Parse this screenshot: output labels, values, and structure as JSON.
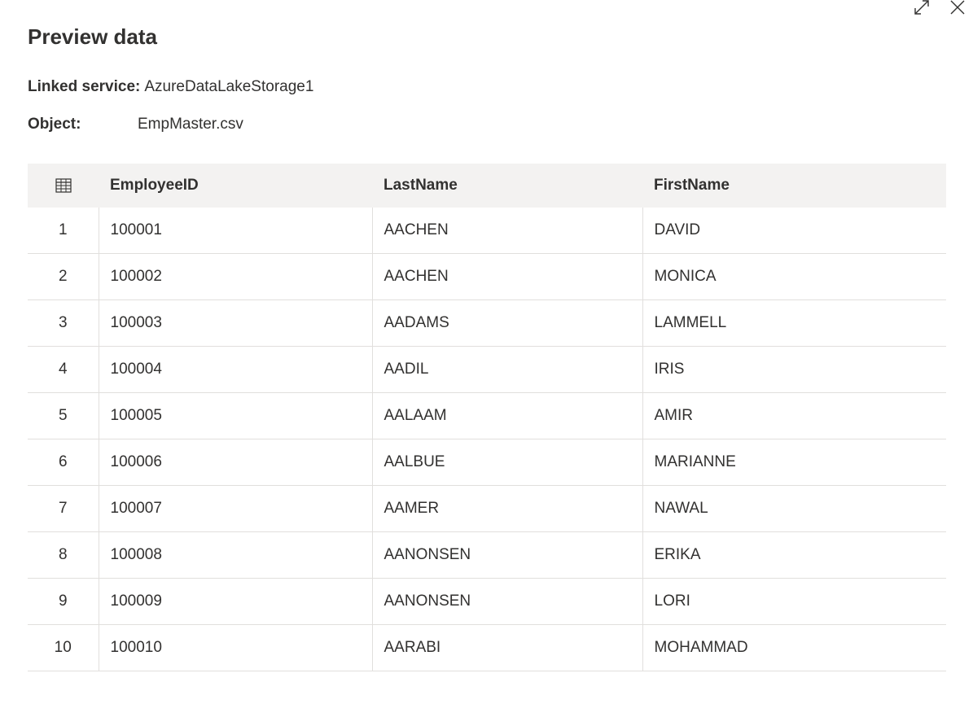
{
  "header": {
    "title": "Preview data",
    "icons": [
      "expand-icon",
      "close-icon"
    ]
  },
  "meta": {
    "linked_service_label": "Linked service:",
    "linked_service_value": "AzureDataLakeStorage1",
    "object_label": "Object:",
    "object_value": "EmpMaster.csv"
  },
  "table": {
    "index_icon": "table-icon",
    "columns": [
      "EmployeeID",
      "LastName",
      "FirstName"
    ],
    "rows": [
      {
        "idx": "1",
        "cells": [
          "100001",
          "AACHEN",
          "DAVID"
        ]
      },
      {
        "idx": "2",
        "cells": [
          "100002",
          "AACHEN",
          "MONICA"
        ]
      },
      {
        "idx": "3",
        "cells": [
          "100003",
          "AADAMS",
          "LAMMELL"
        ]
      },
      {
        "idx": "4",
        "cells": [
          "100004",
          "AADIL",
          "IRIS"
        ]
      },
      {
        "idx": "5",
        "cells": [
          "100005",
          "AALAAM",
          "AMIR"
        ]
      },
      {
        "idx": "6",
        "cells": [
          "100006",
          "AALBUE",
          "MARIANNE"
        ]
      },
      {
        "idx": "7",
        "cells": [
          "100007",
          "AAMER",
          "NAWAL"
        ]
      },
      {
        "idx": "8",
        "cells": [
          "100008",
          "AANONSEN",
          "ERIKA"
        ]
      },
      {
        "idx": "9",
        "cells": [
          "100009",
          "AANONSEN",
          "LORI"
        ]
      },
      {
        "idx": "10",
        "cells": [
          "100010",
          "AARABI",
          "MOHAMMAD"
        ]
      }
    ]
  }
}
